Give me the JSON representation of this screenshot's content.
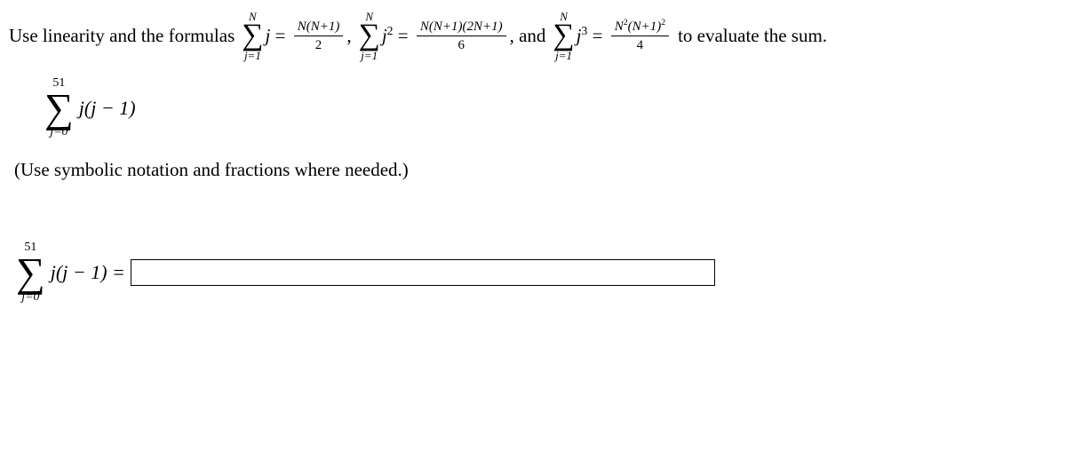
{
  "instruction": {
    "lead": "Use linearity and the formulas",
    "sum1": {
      "top": "N",
      "bottom": "j=1",
      "term": "j",
      "rhs_num": "N(N+1)",
      "rhs_den": "2"
    },
    "sep1": ",",
    "sum2": {
      "top": "N",
      "bottom": "j=1",
      "term": "j",
      "term_exp": "2",
      "rhs_num": "N(N+1)(2N+1)",
      "rhs_den": "6"
    },
    "sep2": ", and",
    "sum3": {
      "top": "N",
      "bottom": "j=1",
      "term": "j",
      "term_exp": "3",
      "rhs_num_outer": "N",
      "rhs_num_outer_exp": "2",
      "rhs_num_inner": "(N+1)",
      "rhs_num_inner_exp": "2",
      "rhs_den": "4"
    },
    "tail": "to evaluate the sum."
  },
  "problem": {
    "upper": "51",
    "lower": "j=0",
    "expr": "j(j − 1)"
  },
  "hint": "(Use symbolic notation and fractions where needed.)",
  "answer": {
    "upper": "51",
    "lower": "j=0",
    "expr": "j(j − 1) ="
  },
  "input": {
    "value": ""
  }
}
